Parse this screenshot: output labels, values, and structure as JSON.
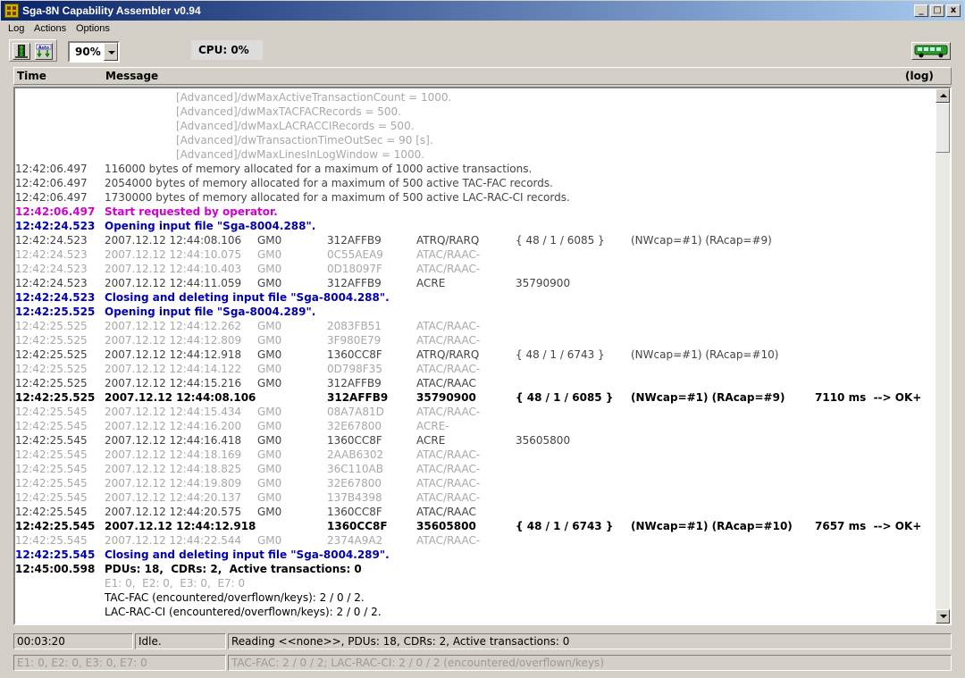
{
  "window": {
    "title": "Sga-8N Capability Assembler  v0.94",
    "min": "_",
    "max": "□",
    "close": "x"
  },
  "menu": [
    "Log",
    "Actions",
    "Options"
  ],
  "toolbar": {
    "zoom": "90%",
    "cpu": "CPU:  0%"
  },
  "columns": {
    "time": "Time",
    "message": "Message",
    "log": "(log)"
  },
  "config_lines": [
    "[Advanced]/dwMaxActiveTransactionCount = 1000.",
    "[Advanced]/dwMaxTACFACRecords = 500.",
    "[Advanced]/dwMaxLACRACCIRecords = 500.",
    "[Advanced]/dwTransactionTimeOutSec = 90 [s].",
    "[Advanced]/dwMaxLinesInLogWindow = 1000."
  ],
  "msg_lines": [
    {
      "style": "normal",
      "time": "12:42:06.497",
      "msg": "116000 bytes of memory allocated for a maximum of 1000 active transactions."
    },
    {
      "style": "normal",
      "time": "12:42:06.497",
      "msg": "2054000 bytes of memory allocated for a maximum of 500 active TAC-FAC records."
    },
    {
      "style": "normal",
      "time": "12:42:06.497",
      "msg": "1730000 bytes of memory allocated for a maximum of 500 active LAC-RAC-CI records."
    },
    {
      "style": "magenta",
      "time": "12:42:06.497",
      "msg": "Start requested by operator."
    },
    {
      "style": "blue",
      "time": "12:42:24.523",
      "msg": "Opening input file \"Sga-8004.288\"."
    }
  ],
  "record_lines_a": [
    {
      "style": "normal",
      "time": "12:42:24.523",
      "ts": "2007.12.12 12:44:08.106",
      "gm": "GM0",
      "id": "312AFFB9",
      "type": "ATRQ/RARQ",
      "cell": "{ 48 / 1 / 6085 }",
      "cap": "(NWcap=#1) (RAcap=#9)",
      "res": ""
    },
    {
      "style": "faint",
      "time": "12:42:24.523",
      "ts": "2007.12.12 12:44:10.075",
      "gm": "GM0",
      "id": "0C55AEA9",
      "type": "ATAC/RAAC-",
      "cell": "",
      "cap": "",
      "res": ""
    },
    {
      "style": "faint",
      "time": "12:42:24.523",
      "ts": "2007.12.12 12:44:10.403",
      "gm": "GM0",
      "id": "0D18097F",
      "type": "ATAC/RAAC-",
      "cell": "",
      "cap": "",
      "res": ""
    },
    {
      "style": "normal",
      "time": "12:42:24.523",
      "ts": "2007.12.12 12:44:11.059",
      "gm": "GM0",
      "id": "312AFFB9",
      "type": "ACRE",
      "cell": "35790900",
      "cap": "",
      "res": ""
    }
  ],
  "file_lines_a": [
    {
      "style": "blue",
      "time": "12:42:24.523",
      "msg": "Closing and deleting input file \"Sga-8004.288\"."
    },
    {
      "style": "blue",
      "time": "12:42:25.525",
      "msg": "Opening input file \"Sga-8004.289\"."
    }
  ],
  "record_lines_b": [
    {
      "style": "faint",
      "time": "12:42:25.525",
      "ts": "2007.12.12 12:44:12.262",
      "gm": "GM0",
      "id": "2083FB51",
      "type": "ATAC/RAAC-",
      "cell": "",
      "cap": "",
      "res": ""
    },
    {
      "style": "faint",
      "time": "12:42:25.525",
      "ts": "2007.12.12 12:44:12.809",
      "gm": "GM0",
      "id": "3F980E79",
      "type": "ATAC/RAAC-",
      "cell": "",
      "cap": "",
      "res": ""
    },
    {
      "style": "normal",
      "time": "12:42:25.525",
      "ts": "2007.12.12 12:44:12.918",
      "gm": "GM0",
      "id": "1360CC8F",
      "type": "ATRQ/RARQ",
      "cell": "{ 48 / 1 / 6743 }",
      "cap": "(NWcap=#1) (RAcap=#10)",
      "res": ""
    },
    {
      "style": "faint",
      "time": "12:42:25.525",
      "ts": "2007.12.12 12:44:14.122",
      "gm": "GM0",
      "id": "0D798F35",
      "type": "ATAC/RAAC-",
      "cell": "",
      "cap": "",
      "res": ""
    },
    {
      "style": "normal",
      "time": "12:42:25.525",
      "ts": "2007.12.12 12:44:15.216",
      "gm": "GM0",
      "id": "312AFFB9",
      "type": "ATAC/RAAC",
      "cell": "",
      "cap": "",
      "res": ""
    },
    {
      "style": "bold",
      "time": "12:42:25.525",
      "ts": "2007.12.12 12:44:08.106",
      "gm": "",
      "id": "312AFFB9",
      "type": "35790900",
      "cell": "{ 48 / 1 / 6085 }",
      "cap": "(NWcap=#1) (RAcap=#9)",
      "res": "7110 ms  --> OK+"
    },
    {
      "style": "faint",
      "time": "12:42:25.545",
      "ts": "2007.12.12 12:44:15.434",
      "gm": "GM0",
      "id": "08A7A81D",
      "type": "ATAC/RAAC-",
      "cell": "",
      "cap": "",
      "res": ""
    },
    {
      "style": "faint",
      "time": "12:42:25.545",
      "ts": "2007.12.12 12:44:16.200",
      "gm": "GM0",
      "id": "32E67800",
      "type": "ACRE-",
      "cell": "",
      "cap": "",
      "res": ""
    },
    {
      "style": "normal",
      "time": "12:42:25.545",
      "ts": "2007.12.12 12:44:16.418",
      "gm": "GM0",
      "id": "1360CC8F",
      "type": "ACRE",
      "cell": "35605800",
      "cap": "",
      "res": ""
    },
    {
      "style": "faint",
      "time": "12:42:25.545",
      "ts": "2007.12.12 12:44:18.169",
      "gm": "GM0",
      "id": "2AAB6302",
      "type": "ATAC/RAAC-",
      "cell": "",
      "cap": "",
      "res": ""
    },
    {
      "style": "faint",
      "time": "12:42:25.545",
      "ts": "2007.12.12 12:44:18.825",
      "gm": "GM0",
      "id": "36C110AB",
      "type": "ATAC/RAAC-",
      "cell": "",
      "cap": "",
      "res": ""
    },
    {
      "style": "faint",
      "time": "12:42:25.545",
      "ts": "2007.12.12 12:44:19.809",
      "gm": "GM0",
      "id": "32E67800",
      "type": "ATAC/RAAC-",
      "cell": "",
      "cap": "",
      "res": ""
    },
    {
      "style": "faint",
      "time": "12:42:25.545",
      "ts": "2007.12.12 12:44:20.137",
      "gm": "GM0",
      "id": "137B4398",
      "type": "ATAC/RAAC-",
      "cell": "",
      "cap": "",
      "res": ""
    },
    {
      "style": "normal",
      "time": "12:42:25.545",
      "ts": "2007.12.12 12:44:20.575",
      "gm": "GM0",
      "id": "1360CC8F",
      "type": "ATAC/RAAC",
      "cell": "",
      "cap": "",
      "res": ""
    },
    {
      "style": "bold",
      "time": "12:42:25.545",
      "ts": "2007.12.12 12:44:12.918",
      "gm": "",
      "id": "1360CC8F",
      "type": "35605800",
      "cell": "{ 48 / 1 / 6743 }",
      "cap": "(NWcap=#1) (RAcap=#10)",
      "res": "7657 ms  --> OK+"
    },
    {
      "style": "faint",
      "time": "12:42:25.545",
      "ts": "2007.12.12 12:44:22.544",
      "gm": "GM0",
      "id": "2374A9A2",
      "type": "ATAC/RAAC-",
      "cell": "",
      "cap": "",
      "res": ""
    }
  ],
  "tail_lines": [
    {
      "style": "blue",
      "time": "12:42:25.545",
      "msg": "Closing and deleting input file \"Sga-8004.289\"."
    },
    {
      "style": "bold-plain",
      "time": "12:45:00.598",
      "msg": "PDUs: 18,  CDRs: 2,  Active transactions: 0"
    },
    {
      "style": "faint",
      "time": "",
      "msg": "E1: 0,  E2: 0,  E3: 0,  E7: 0"
    },
    {
      "style": "plain",
      "time": "",
      "msg": "TAC-FAC (encountered/overflown/keys): 2 / 0 / 2."
    },
    {
      "style": "plain",
      "time": "",
      "msg": "LAC-RAC-CI (encountered/overflown/keys): 2 / 0 / 2."
    }
  ],
  "status": {
    "elapsed": "00:03:20",
    "state": "Idle.",
    "reading": "Reading <<none>>, PDUs: 18, CDRs: 2, Active transactions: 0",
    "errors": "E1: 0, E2: 0, E3: 0, E7: 0",
    "keys": "TAC-FAC: 2 / 0 / 2;  LAC-RAC-CI: 2 / 0 / 2  (encountered/overflown/keys)"
  },
  "colors": {
    "titlebar_start": "#0a246a",
    "titlebar_end": "#a6caf0",
    "info_blue": "#0000b4",
    "operator_magenta": "#d000d0",
    "faint_gray": "#a8a8a8"
  },
  "icons": [
    "traffic-light-icon",
    "auto-download-icon",
    "bus-icon"
  ]
}
